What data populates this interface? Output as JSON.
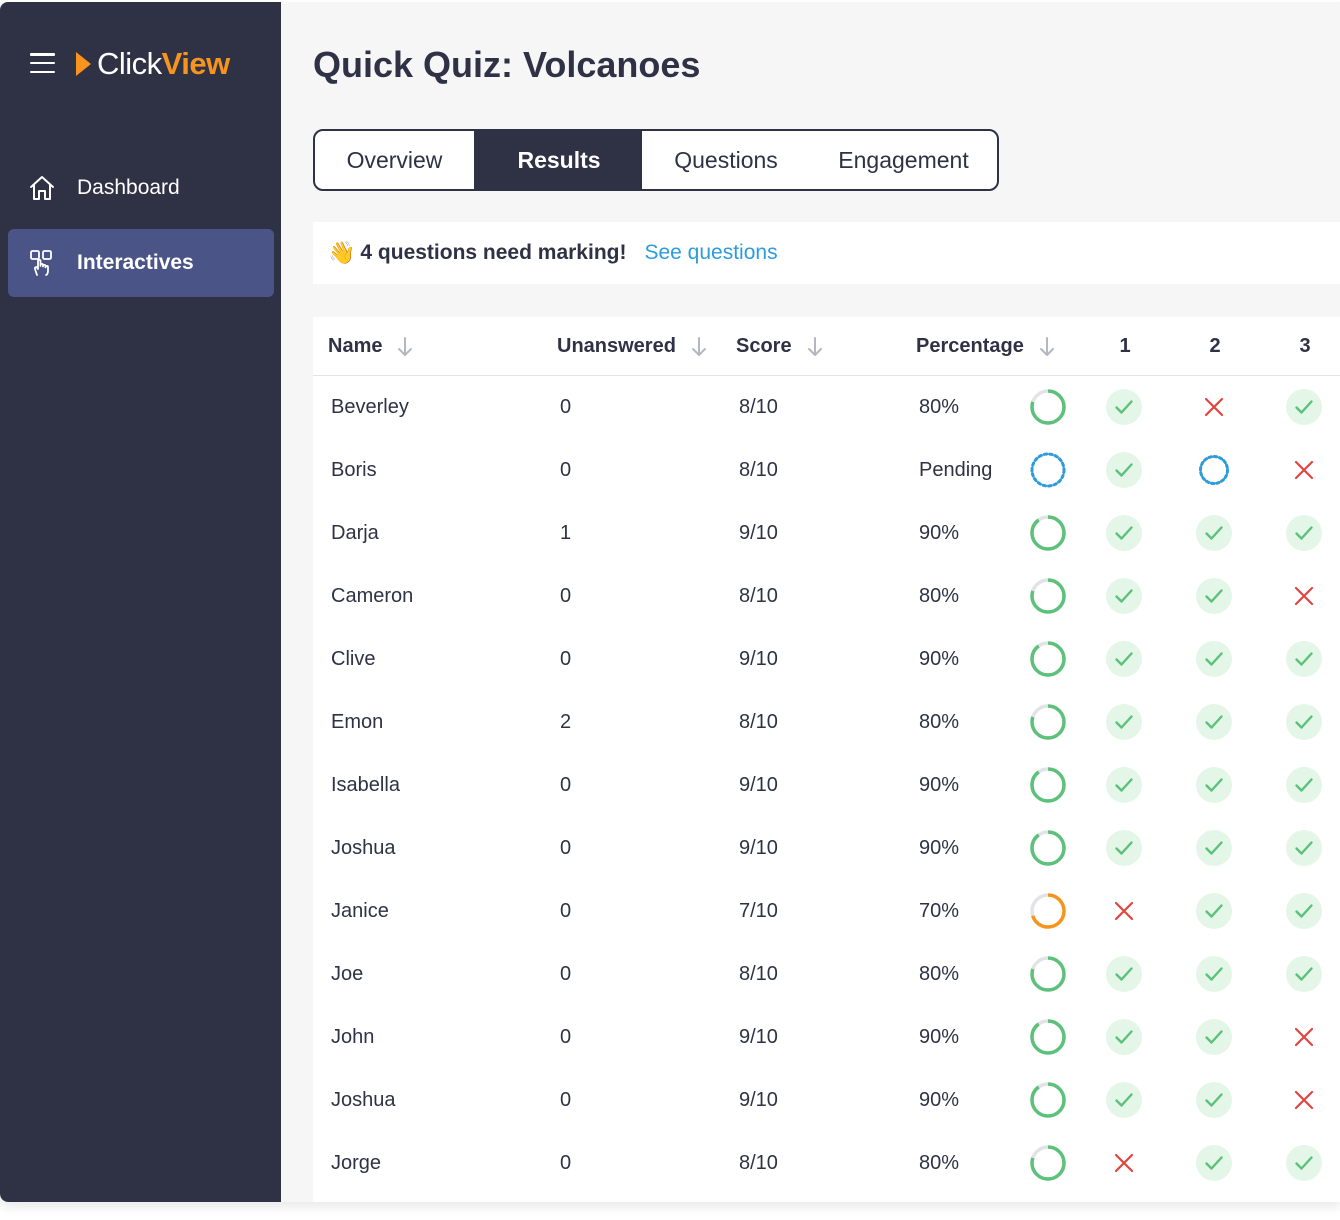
{
  "brand": {
    "word1": "Click",
    "word2": "View",
    "accent": "#f7941d"
  },
  "sidebar": {
    "items": [
      {
        "label": "Dashboard",
        "icon": "home-icon"
      },
      {
        "label": "Interactives",
        "icon": "touch-icon",
        "active": true
      }
    ]
  },
  "page": {
    "title": "Quick Quiz: Volcanoes"
  },
  "tabs": [
    {
      "label": "Overview"
    },
    {
      "label": "Results",
      "active": true
    },
    {
      "label": "Questions"
    },
    {
      "label": "Engagement"
    }
  ],
  "banner": {
    "emoji": "👋",
    "message": "4 questions need marking!",
    "link": "See questions"
  },
  "table": {
    "columns": {
      "name": "Name",
      "unanswered": "Unanswered",
      "score": "Score",
      "percentage": "Percentage",
      "questions": [
        "1",
        "2",
        "3"
      ]
    },
    "rows": [
      {
        "name": "Beverley",
        "unanswered": "0",
        "score": "8/10",
        "percentage": "80%",
        "progress": 0.8,
        "status": "graded",
        "q": [
          "correct",
          "wrong",
          "correct"
        ]
      },
      {
        "name": "Boris",
        "unanswered": "0",
        "score": "8/10",
        "percentage": "Pending",
        "progress": 0,
        "status": "pending",
        "q": [
          "correct",
          "pending",
          "wrong"
        ]
      },
      {
        "name": "Darja",
        "unanswered": "1",
        "score": "9/10",
        "percentage": "90%",
        "progress": 0.9,
        "status": "graded",
        "q": [
          "correct",
          "correct",
          "correct"
        ]
      },
      {
        "name": "Cameron",
        "unanswered": "0",
        "score": "8/10",
        "percentage": "80%",
        "progress": 0.8,
        "status": "graded",
        "q": [
          "correct",
          "correct",
          "wrong"
        ]
      },
      {
        "name": "Clive",
        "unanswered": "0",
        "score": "9/10",
        "percentage": "90%",
        "progress": 0.9,
        "status": "graded",
        "q": [
          "correct",
          "correct",
          "correct"
        ]
      },
      {
        "name": "Emon",
        "unanswered": "2",
        "score": "8/10",
        "percentage": "80%",
        "progress": 0.8,
        "status": "graded",
        "q": [
          "correct",
          "correct",
          "correct"
        ]
      },
      {
        "name": "Isabella",
        "unanswered": "0",
        "score": "9/10",
        "percentage": "90%",
        "progress": 0.9,
        "status": "graded",
        "q": [
          "correct",
          "correct",
          "correct"
        ]
      },
      {
        "name": "Joshua",
        "unanswered": "0",
        "score": "9/10",
        "percentage": "90%",
        "progress": 0.9,
        "status": "graded",
        "q": [
          "correct",
          "correct",
          "correct"
        ]
      },
      {
        "name": "Janice",
        "unanswered": "0",
        "score": "7/10",
        "percentage": "70%",
        "progress": 0.7,
        "status": "graded",
        "q": [
          "wrong",
          "correct",
          "correct"
        ]
      },
      {
        "name": "Joe",
        "unanswered": "0",
        "score": "8/10",
        "percentage": "80%",
        "progress": 0.8,
        "status": "graded",
        "q": [
          "correct",
          "correct",
          "correct"
        ]
      },
      {
        "name": "John",
        "unanswered": "0",
        "score": "9/10",
        "percentage": "90%",
        "progress": 0.9,
        "status": "graded",
        "q": [
          "correct",
          "correct",
          "wrong"
        ]
      },
      {
        "name": "Joshua",
        "unanswered": "0",
        "score": "9/10",
        "percentage": "90%",
        "progress": 0.9,
        "status": "graded",
        "q": [
          "correct",
          "correct",
          "wrong"
        ]
      },
      {
        "name": "Jorge",
        "unanswered": "0",
        "score": "8/10",
        "percentage": "80%",
        "progress": 0.8,
        "status": "graded",
        "q": [
          "wrong",
          "correct",
          "correct"
        ]
      }
    ]
  },
  "colors": {
    "sidebar": "#2f3245",
    "activeNav": "#4a5487",
    "correct": "#5cc17a",
    "correctBg": "#e4f6e7",
    "wrong": "#e0463f",
    "pending": "#2d9cdb",
    "warning": "#f7941d",
    "link": "#2d9cdb"
  }
}
